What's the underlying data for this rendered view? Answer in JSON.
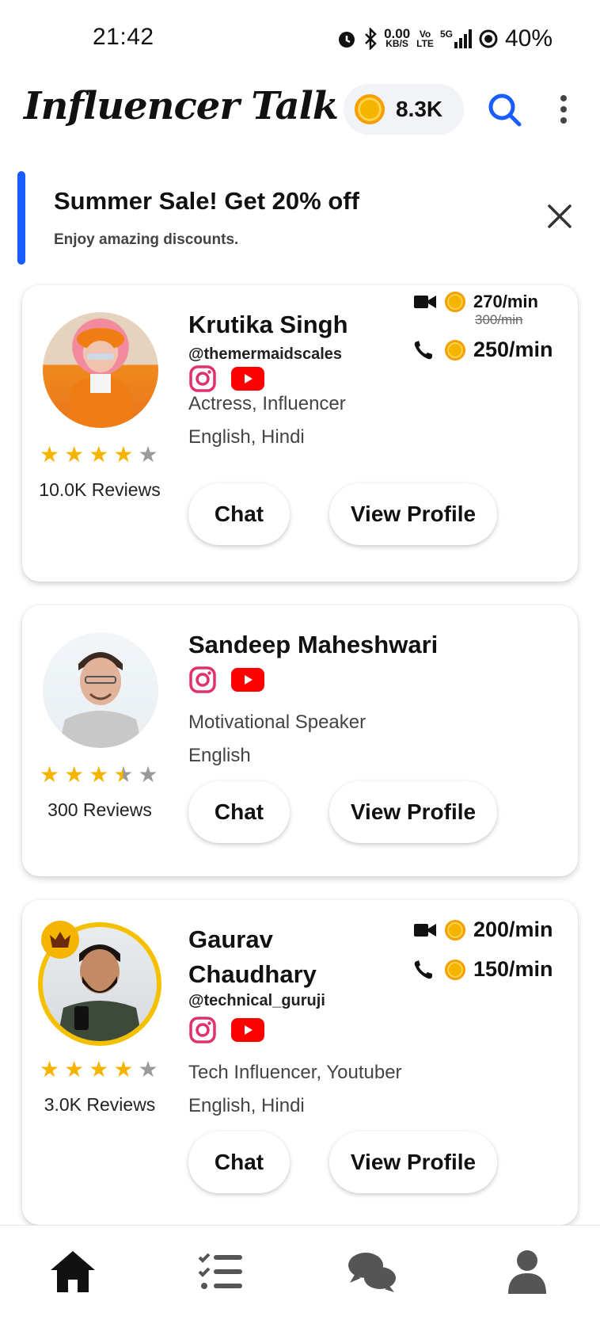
{
  "status_bar": {
    "time": "21:42",
    "net_speed": "0.00",
    "net_unit": "KB/S",
    "volte": "Vo",
    "lte": "LTE",
    "signal": "5G",
    "battery": "40%"
  },
  "header": {
    "title": "Influencer Talk",
    "coins": "8.3K"
  },
  "banner": {
    "title": "Summer Sale! Get 20% off",
    "subtitle": "Enjoy amazing discounts."
  },
  "influencers": [
    {
      "name": "Krutika Singh",
      "handle": "@themermaidscales",
      "categories": "Actress, Influencer",
      "languages": "English, Hindi",
      "reviews": "10.0K Reviews",
      "rating": 4,
      "video_rate": "270/min",
      "video_rate_old": "300/min",
      "call_rate": "250/min",
      "chat_label": "Chat",
      "view_label": "View Profile"
    },
    {
      "name": "Sandeep Maheshwari",
      "categories": "Motivational Speaker",
      "languages": "English",
      "reviews": "300 Reviews",
      "rating": 3.5,
      "chat_label": "Chat",
      "view_label": "View Profile"
    },
    {
      "name_line1": "Gaurav",
      "name_line2": "Chaudhary",
      "handle": "@technical_guruji",
      "categories": "Tech Influencer, Youtuber",
      "languages": "English, Hindi",
      "reviews": "3.0K Reviews",
      "rating": 4,
      "video_rate": "200/min",
      "call_rate": "150/min",
      "chat_label": "Chat",
      "view_label": "View Profile"
    }
  ],
  "colors": {
    "accent": "#1a5cff",
    "star": "#f5b400",
    "youtube": "#ff0000",
    "instagram": "#e1306c"
  }
}
